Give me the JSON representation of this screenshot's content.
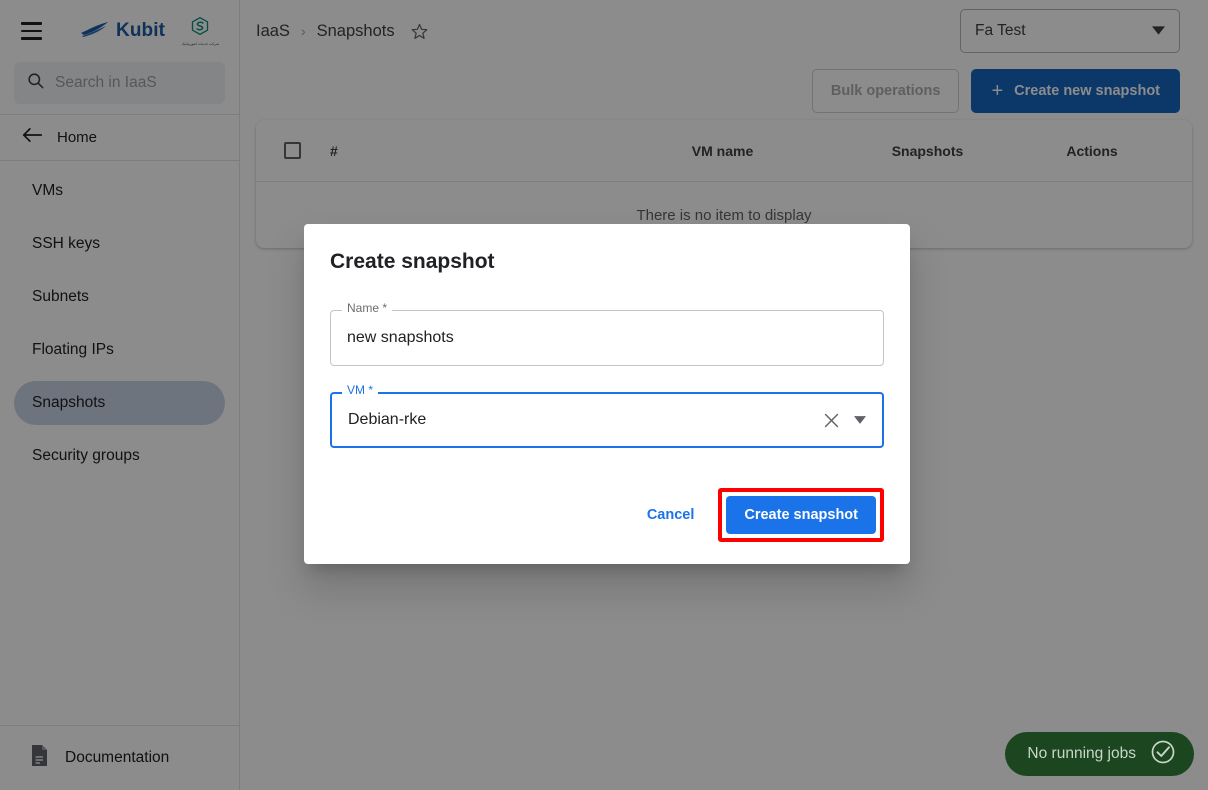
{
  "app": {
    "brand_name": "Kubit",
    "partner_caption": "شرکت خدمات انفورماتیک",
    "menu_icon": "hamburger-menu-icon",
    "logo_icon": "kubit-wave-logo-icon",
    "partner_logo_icon": "partner-hexagon-s-logo-icon"
  },
  "search": {
    "placeholder": "Search in IaaS",
    "value": "",
    "icon": "search-icon"
  },
  "sidebar": {
    "home_label": "Home",
    "back_icon": "arrow-left-icon",
    "items": [
      {
        "label": "VMs",
        "active": false
      },
      {
        "label": "SSH keys",
        "active": false
      },
      {
        "label": "Subnets",
        "active": false
      },
      {
        "label": "Floating IPs",
        "active": false
      },
      {
        "label": "Snapshots",
        "active": true
      },
      {
        "label": "Security groups",
        "active": false
      }
    ],
    "documentation_label": "Documentation",
    "documentation_icon": "document-icon"
  },
  "header": {
    "breadcrumb": [
      "IaaS",
      "Snapshots"
    ],
    "breadcrumb_separator": "›",
    "favorite_icon": "star-outline-icon",
    "tenant": {
      "value": "Fa Test",
      "arrow_icon": "chevron-down-icon"
    }
  },
  "toolbar": {
    "bulk_operations_label": "Bulk operations",
    "create_label": "Create new snapshot",
    "create_icon": "plus-icon"
  },
  "table": {
    "columns": [
      "#",
      "VM name",
      "Snapshots",
      "Actions"
    ],
    "select_all_icon": "checkbox-unchecked-icon",
    "empty_message": "There is no item to display",
    "rows": []
  },
  "dialog": {
    "title": "Create snapshot",
    "name_field": {
      "label": "Name *",
      "value": "new snapshots",
      "focused": false
    },
    "vm_field": {
      "label": "VM *",
      "value": "Debian-rke",
      "focused": true,
      "clear_icon": "close-x-icon",
      "arrow_icon": "chevron-down-icon"
    },
    "cancel_label": "Cancel",
    "submit_label": "Create snapshot",
    "submit_highlighted": true
  },
  "toast": {
    "text": "No running jobs",
    "icon": "check-circle-icon"
  },
  "colors": {
    "primary_blue": "#1a73e8",
    "header_button_blue": "#1565c0",
    "brand_blue": "#1d5ba4",
    "active_nav": "#c8d3e6",
    "toast_green": "#1b4620",
    "highlight_red": "#ff0000"
  }
}
